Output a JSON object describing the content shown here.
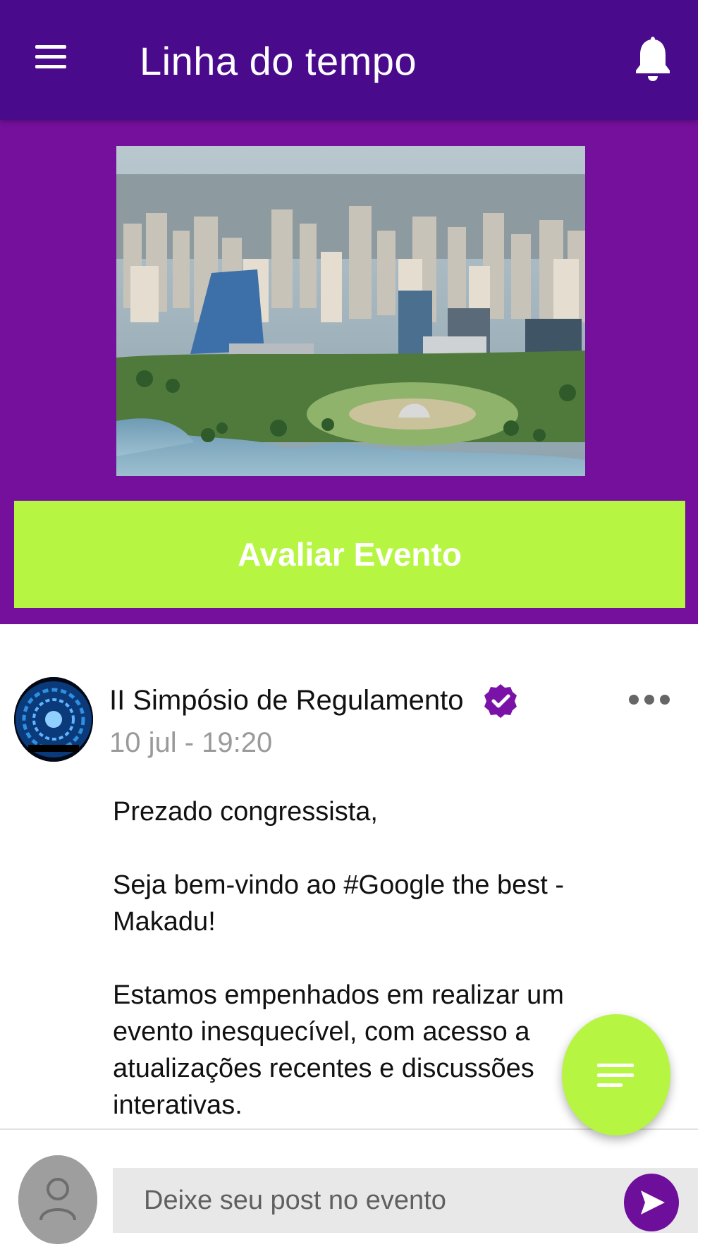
{
  "app_bar": {
    "title": "Linha do tempo",
    "menu_icon": "hamburger-menu-icon",
    "notification_icon": "bell-icon"
  },
  "hero": {
    "image_description": "aerial-city-photo",
    "rate_button_label": "Avaliar Evento"
  },
  "post": {
    "author": "II Simpósio de Regulamento",
    "verified_icon": "verified-check-icon",
    "timestamp": "10 jul - 19:20",
    "paragraphs": [
      "Prezado congressista,",
      "Seja bem-vindo ao #Google the best - Makadu!",
      "Estamos empenhados em realizar um evento inesquecível, com acesso a atualizações recentes e discussões interativas."
    ]
  },
  "composer": {
    "placeholder": "Deixe seu post no evento",
    "send_icon": "send-icon"
  },
  "colors": {
    "app_bar": "#4a0a8c",
    "hero_background": "#74109c",
    "accent_green": "#b6f542",
    "verified_purple": "#7a12a8"
  }
}
